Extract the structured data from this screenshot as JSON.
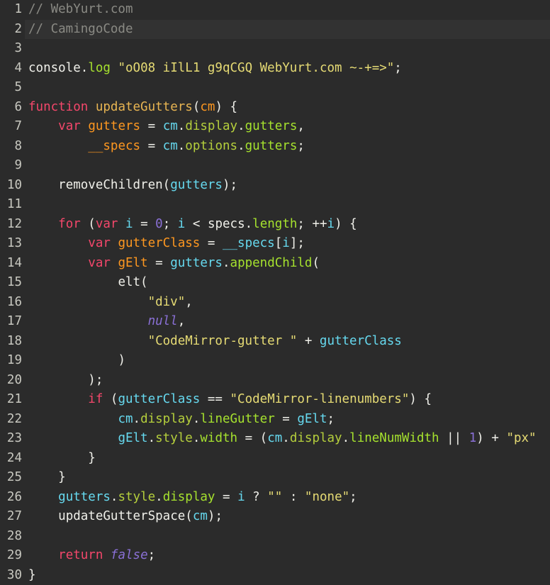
{
  "editor": {
    "name": "code-editor",
    "language": "javascript",
    "theme": "monokai-dark",
    "font_sample_text": "CamingoCode",
    "background_color": "#2b2b2b",
    "active_line_background": "#323232",
    "gutter_text_color": "#c8c8c0",
    "active_line_number": 2,
    "total_lines": 30,
    "first_visible_line": 1,
    "colors": {
      "comment": "#8a8a84",
      "keyword": "#f4476b",
      "function": "#e8b552",
      "variable": "#fd9720",
      "string": "#e6db74",
      "property": "#a6e22e",
      "property_alt": "#b5cf3c",
      "identifier": "#66d9ef",
      "number": "#8a70d6",
      "constant": "#8a70d6",
      "plain": "#f0f0ea"
    },
    "lines": [
      {
        "number": "1",
        "active": false,
        "tokens": [
          {
            "text": "// WebYurt.com",
            "type": "comment"
          }
        ]
      },
      {
        "number": "2",
        "active": true,
        "tokens": [
          {
            "text": "// CamingoCode",
            "type": "comment"
          }
        ]
      },
      {
        "number": "3",
        "active": false,
        "tokens": []
      },
      {
        "number": "4",
        "active": false,
        "tokens": [
          {
            "text": "console",
            "type": "plain"
          },
          {
            "text": ".",
            "type": "punc"
          },
          {
            "text": "log",
            "type": "prop"
          },
          {
            "text": " ",
            "type": "plain"
          },
          {
            "text": "\"oO08 iIlL1 g9qCGQ WebYurt.com ~-+=>\"",
            "type": "string"
          },
          {
            "text": ";",
            "type": "punc"
          }
        ]
      },
      {
        "number": "5",
        "active": false,
        "tokens": []
      },
      {
        "number": "6",
        "active": false,
        "tokens": [
          {
            "text": "function",
            "type": "keyword"
          },
          {
            "text": " ",
            "type": "plain"
          },
          {
            "text": "updateGutters",
            "type": "func"
          },
          {
            "text": "(",
            "type": "punc"
          },
          {
            "text": "cm",
            "type": "var"
          },
          {
            "text": ") {",
            "type": "punc"
          }
        ]
      },
      {
        "number": "7",
        "active": false,
        "tokens": [
          {
            "text": "    ",
            "type": "plain"
          },
          {
            "text": "var",
            "type": "keyword"
          },
          {
            "text": " ",
            "type": "plain"
          },
          {
            "text": "gutters",
            "type": "var"
          },
          {
            "text": " = ",
            "type": "op"
          },
          {
            "text": "cm",
            "type": "ident"
          },
          {
            "text": ".",
            "type": "punc"
          },
          {
            "text": "display",
            "type": "prop2"
          },
          {
            "text": ".",
            "type": "punc"
          },
          {
            "text": "gutters",
            "type": "prop"
          },
          {
            "text": ",",
            "type": "punc"
          }
        ]
      },
      {
        "number": "8",
        "active": false,
        "tokens": [
          {
            "text": "        ",
            "type": "plain"
          },
          {
            "text": "__specs",
            "type": "var"
          },
          {
            "text": " = ",
            "type": "op"
          },
          {
            "text": "cm",
            "type": "ident"
          },
          {
            "text": ".",
            "type": "punc"
          },
          {
            "text": "options",
            "type": "prop2"
          },
          {
            "text": ".",
            "type": "punc"
          },
          {
            "text": "gutters",
            "type": "prop"
          },
          {
            "text": ";",
            "type": "punc"
          }
        ]
      },
      {
        "number": "9",
        "active": false,
        "tokens": []
      },
      {
        "number": "10",
        "active": false,
        "tokens": [
          {
            "text": "    ",
            "type": "plain"
          },
          {
            "text": "removeChildren",
            "type": "plain"
          },
          {
            "text": "(",
            "type": "punc"
          },
          {
            "text": "gutters",
            "type": "ident"
          },
          {
            "text": ");",
            "type": "punc"
          }
        ]
      },
      {
        "number": "11",
        "active": false,
        "tokens": []
      },
      {
        "number": "12",
        "active": false,
        "tokens": [
          {
            "text": "    ",
            "type": "plain"
          },
          {
            "text": "for",
            "type": "keyword"
          },
          {
            "text": " (",
            "type": "punc"
          },
          {
            "text": "var",
            "type": "keyword"
          },
          {
            "text": " ",
            "type": "plain"
          },
          {
            "text": "i",
            "type": "ident"
          },
          {
            "text": " = ",
            "type": "op"
          },
          {
            "text": "0",
            "type": "num"
          },
          {
            "text": "; ",
            "type": "punc"
          },
          {
            "text": "i",
            "type": "ident"
          },
          {
            "text": " < ",
            "type": "op"
          },
          {
            "text": "specs",
            "type": "plain"
          },
          {
            "text": ".",
            "type": "punc"
          },
          {
            "text": "length",
            "type": "prop"
          },
          {
            "text": "; ++",
            "type": "op"
          },
          {
            "text": "i",
            "type": "ident"
          },
          {
            "text": ") {",
            "type": "punc"
          }
        ]
      },
      {
        "number": "13",
        "active": false,
        "tokens": [
          {
            "text": "        ",
            "type": "plain"
          },
          {
            "text": "var",
            "type": "keyword"
          },
          {
            "text": " ",
            "type": "plain"
          },
          {
            "text": "gutterClass",
            "type": "var"
          },
          {
            "text": " = ",
            "type": "op"
          },
          {
            "text": "__specs",
            "type": "ident"
          },
          {
            "text": "[",
            "type": "punc"
          },
          {
            "text": "i",
            "type": "ident"
          },
          {
            "text": "];",
            "type": "punc"
          }
        ]
      },
      {
        "number": "14",
        "active": false,
        "tokens": [
          {
            "text": "        ",
            "type": "plain"
          },
          {
            "text": "var",
            "type": "keyword"
          },
          {
            "text": " ",
            "type": "plain"
          },
          {
            "text": "gElt",
            "type": "var"
          },
          {
            "text": " = ",
            "type": "op"
          },
          {
            "text": "gutters",
            "type": "ident"
          },
          {
            "text": ".",
            "type": "punc"
          },
          {
            "text": "appendChild",
            "type": "prop"
          },
          {
            "text": "(",
            "type": "punc"
          }
        ]
      },
      {
        "number": "15",
        "active": false,
        "tokens": [
          {
            "text": "            ",
            "type": "plain"
          },
          {
            "text": "elt",
            "type": "plain"
          },
          {
            "text": "(",
            "type": "punc"
          }
        ]
      },
      {
        "number": "16",
        "active": false,
        "tokens": [
          {
            "text": "                ",
            "type": "plain"
          },
          {
            "text": "\"div\"",
            "type": "string"
          },
          {
            "text": ",",
            "type": "punc"
          }
        ]
      },
      {
        "number": "17",
        "active": false,
        "tokens": [
          {
            "text": "                ",
            "type": "plain"
          },
          {
            "text": "null",
            "type": "const"
          },
          {
            "text": ",",
            "type": "punc"
          }
        ]
      },
      {
        "number": "18",
        "active": false,
        "tokens": [
          {
            "text": "                ",
            "type": "plain"
          },
          {
            "text": "\"CodeMirror-gutter \"",
            "type": "string"
          },
          {
            "text": " + ",
            "type": "op"
          },
          {
            "text": "gutterClass",
            "type": "ident"
          }
        ]
      },
      {
        "number": "19",
        "active": false,
        "tokens": [
          {
            "text": "            ",
            "type": "plain"
          },
          {
            "text": ")",
            "type": "punc"
          }
        ]
      },
      {
        "number": "20",
        "active": false,
        "tokens": [
          {
            "text": "        ",
            "type": "plain"
          },
          {
            "text": ");",
            "type": "punc"
          }
        ]
      },
      {
        "number": "21",
        "active": false,
        "tokens": [
          {
            "text": "        ",
            "type": "plain"
          },
          {
            "text": "if",
            "type": "keyword"
          },
          {
            "text": " (",
            "type": "punc"
          },
          {
            "text": "gutterClass",
            "type": "ident"
          },
          {
            "text": " == ",
            "type": "op"
          },
          {
            "text": "\"CodeMirror-linenumbers\"",
            "type": "string"
          },
          {
            "text": ") {",
            "type": "punc"
          }
        ]
      },
      {
        "number": "22",
        "active": false,
        "tokens": [
          {
            "text": "            ",
            "type": "plain"
          },
          {
            "text": "cm",
            "type": "ident"
          },
          {
            "text": ".",
            "type": "punc"
          },
          {
            "text": "display",
            "type": "prop2"
          },
          {
            "text": ".",
            "type": "punc"
          },
          {
            "text": "lineGutter",
            "type": "prop"
          },
          {
            "text": " = ",
            "type": "op"
          },
          {
            "text": "gElt",
            "type": "ident"
          },
          {
            "text": ";",
            "type": "punc"
          }
        ]
      },
      {
        "number": "23",
        "active": false,
        "tokens": [
          {
            "text": "            ",
            "type": "plain"
          },
          {
            "text": "gElt",
            "type": "ident"
          },
          {
            "text": ".",
            "type": "punc"
          },
          {
            "text": "style",
            "type": "prop2"
          },
          {
            "text": ".",
            "type": "punc"
          },
          {
            "text": "width",
            "type": "prop"
          },
          {
            "text": " = (",
            "type": "op"
          },
          {
            "text": "cm",
            "type": "ident"
          },
          {
            "text": ".",
            "type": "punc"
          },
          {
            "text": "display",
            "type": "prop2"
          },
          {
            "text": ".",
            "type": "punc"
          },
          {
            "text": "lineNumWidth",
            "type": "prop"
          },
          {
            "text": " || ",
            "type": "op"
          },
          {
            "text": "1",
            "type": "num"
          },
          {
            "text": ") + ",
            "type": "op"
          },
          {
            "text": "\"px\"",
            "type": "string"
          }
        ]
      },
      {
        "number": "24",
        "active": false,
        "tokens": [
          {
            "text": "        ",
            "type": "plain"
          },
          {
            "text": "}",
            "type": "punc"
          }
        ]
      },
      {
        "number": "25",
        "active": false,
        "tokens": [
          {
            "text": "    ",
            "type": "plain"
          },
          {
            "text": "}",
            "type": "punc"
          }
        ]
      },
      {
        "number": "26",
        "active": false,
        "tokens": [
          {
            "text": "    ",
            "type": "plain"
          },
          {
            "text": "gutters",
            "type": "ident"
          },
          {
            "text": ".",
            "type": "punc"
          },
          {
            "text": "style",
            "type": "prop2"
          },
          {
            "text": ".",
            "type": "punc"
          },
          {
            "text": "display",
            "type": "prop"
          },
          {
            "text": " = ",
            "type": "op"
          },
          {
            "text": "i",
            "type": "ident"
          },
          {
            "text": " ? ",
            "type": "op"
          },
          {
            "text": "\"\"",
            "type": "string"
          },
          {
            "text": " : ",
            "type": "op"
          },
          {
            "text": "\"none\"",
            "type": "string"
          },
          {
            "text": ";",
            "type": "punc"
          }
        ]
      },
      {
        "number": "27",
        "active": false,
        "tokens": [
          {
            "text": "    ",
            "type": "plain"
          },
          {
            "text": "updateGutterSpace",
            "type": "plain"
          },
          {
            "text": "(",
            "type": "punc"
          },
          {
            "text": "cm",
            "type": "ident"
          },
          {
            "text": ");",
            "type": "punc"
          }
        ]
      },
      {
        "number": "28",
        "active": false,
        "tokens": []
      },
      {
        "number": "29",
        "active": false,
        "tokens": [
          {
            "text": "    ",
            "type": "plain"
          },
          {
            "text": "return",
            "type": "keyword"
          },
          {
            "text": " ",
            "type": "plain"
          },
          {
            "text": "false",
            "type": "const"
          },
          {
            "text": ";",
            "type": "punc"
          }
        ]
      },
      {
        "number": "30",
        "active": false,
        "tokens": [
          {
            "text": "}",
            "type": "punc"
          }
        ]
      }
    ]
  }
}
